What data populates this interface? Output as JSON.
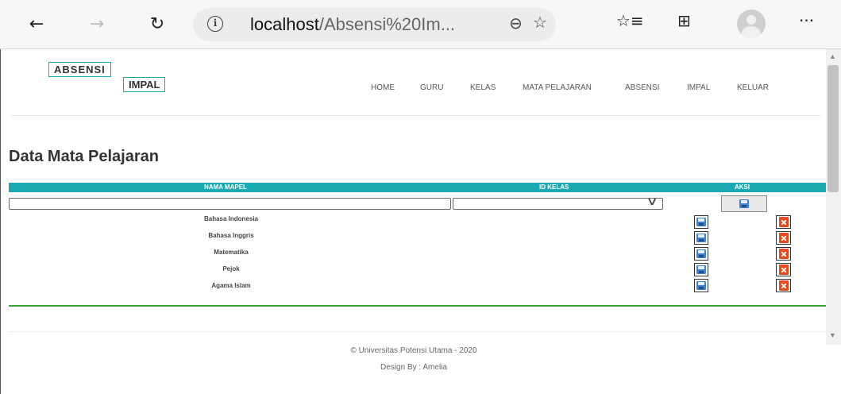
{
  "browser": {
    "url_host": "localhost",
    "url_path": "/Absensi%20Im...",
    "back_icon": "←",
    "forward_icon": "→",
    "refresh_icon": "↻",
    "zoom_icon": "⊖",
    "star_icon": "☆",
    "favorites_icon": "☆≡",
    "collections_icon": "⊞",
    "more_icon": "···"
  },
  "site": {
    "logo_line1": "ABSENSI",
    "logo_line2": "IMPAL",
    "menu": [
      "HOME",
      "GURU",
      "KELAS",
      "MATA PELAJARAN",
      "ABSENSI",
      "IMPAL",
      "KELUAR"
    ]
  },
  "main": {
    "title": "Data Mata Pelajaran",
    "columns": [
      "NAMA MAPEL",
      "ID KELAS",
      "AKSI"
    ],
    "rows": [
      {
        "nama": "Bahasa Indonesia"
      },
      {
        "nama": "Bahasa Inggris"
      },
      {
        "nama": "Matematika"
      },
      {
        "nama": "Pejok"
      },
      {
        "nama": "Agama Islam"
      }
    ]
  },
  "footer": {
    "copyright": "© Universitas Potensi Utama - 2020",
    "design": "Design By : Amelia"
  },
  "colors": {
    "accent": "#1aa9b0",
    "divider": "#3aa63a"
  }
}
